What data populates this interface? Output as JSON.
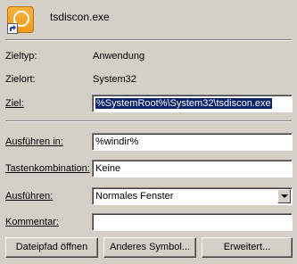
{
  "file_name": "tsdiscon.exe",
  "fields": {
    "type_label": "Zieltyp:",
    "type_value": "Anwendung",
    "location_label": "Zielort:",
    "location_value": "System32",
    "target_label": "Ziel:",
    "target_value": "%SystemRoot%\\System32\\tsdiscon.exe",
    "workdir_label": "Ausführen in:",
    "workdir_value": "%windir%",
    "hotkey_label": "Tastenkombination:",
    "hotkey_value": "Keine",
    "run_label": "Ausführen:",
    "run_value": "Normales Fenster",
    "comment_label": "Kommentar:",
    "comment_value": ""
  },
  "buttons": {
    "open_path": "Dateipfad öffnen",
    "change_icon": "Anderes Symbol...",
    "advanced": "Erweitert..."
  },
  "icon": {
    "name": "shortcut-app-icon",
    "color": "#f29a1c"
  }
}
